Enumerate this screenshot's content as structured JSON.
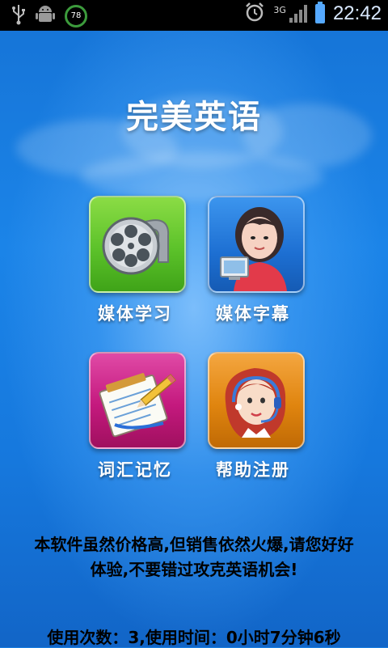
{
  "status_bar": {
    "battery_level": "78",
    "network_type": "3G",
    "time": "22:42",
    "icons": [
      "usb-icon",
      "android-debug-icon",
      "battery-circle-icon",
      "alarm-icon",
      "signal-icon",
      "battery-charging-icon"
    ]
  },
  "app": {
    "title": "完美英语"
  },
  "menu": {
    "items": [
      {
        "label": "媒体学习",
        "icon": "film-reel-icon",
        "color": "#56c423"
      },
      {
        "label": "媒体字幕",
        "icon": "woman-at-computer-icon",
        "color": "#1b6fd1"
      },
      {
        "label": "词汇记忆",
        "icon": "notepad-pencil-icon",
        "color": "#c4197e"
      },
      {
        "label": "帮助注册",
        "icon": "headset-operator-icon",
        "color": "#e0850f"
      }
    ]
  },
  "notice": {
    "line1": "本软件虽然价格高,但销售依然火爆,请您好好",
    "line2": "体验,不要错过攻克英语机会!"
  },
  "usage": {
    "text": "使用次数：3,使用时间：0小时7分钟6秒"
  }
}
